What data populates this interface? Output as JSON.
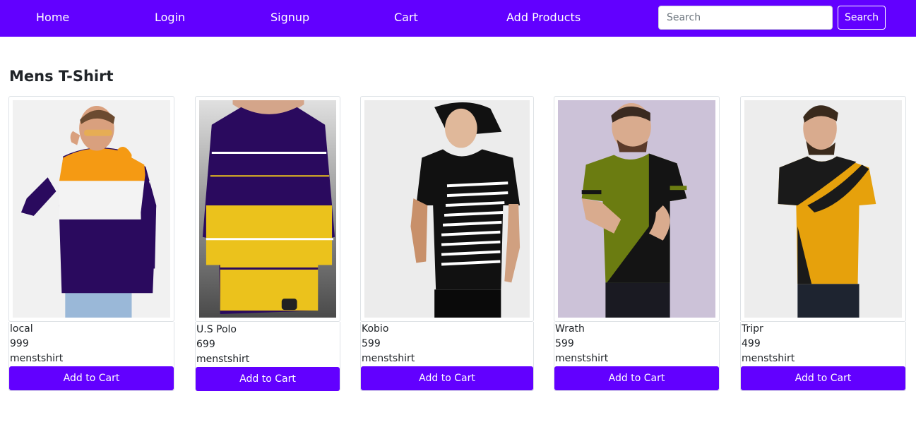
{
  "nav": {
    "links": [
      "Home",
      "Login",
      "Signup",
      "Cart",
      "Add Products"
    ],
    "search_placeholder": "Search",
    "search_button": "Search"
  },
  "section": {
    "title": "Mens T-Shirt"
  },
  "products": [
    {
      "name": "local",
      "price": "999",
      "category": "menstshirt",
      "button": "Add to Cart",
      "image": "tshirt-orange-white-navy-hoodie"
    },
    {
      "name": "U.S Polo",
      "price": "699",
      "category": "menstshirt",
      "button": "Add to Cart",
      "image": "tshirt-navy-yellow-striped"
    },
    {
      "name": "Kobio",
      "price": "599",
      "category": "menstshirt",
      "button": "Add to Cart",
      "image": "tshirt-black-white-stripes"
    },
    {
      "name": "Wrath",
      "price": "599",
      "category": "menstshirt",
      "button": "Add to Cart",
      "image": "tshirt-olive-black-split"
    },
    {
      "name": "Tripr",
      "price": "499",
      "category": "menstshirt",
      "button": "Add to Cart",
      "image": "tshirt-mustard-black-diagonal"
    }
  ],
  "colors": {
    "primary": "#6200ff",
    "white": "#ffffff",
    "border": "#dee2e6"
  }
}
